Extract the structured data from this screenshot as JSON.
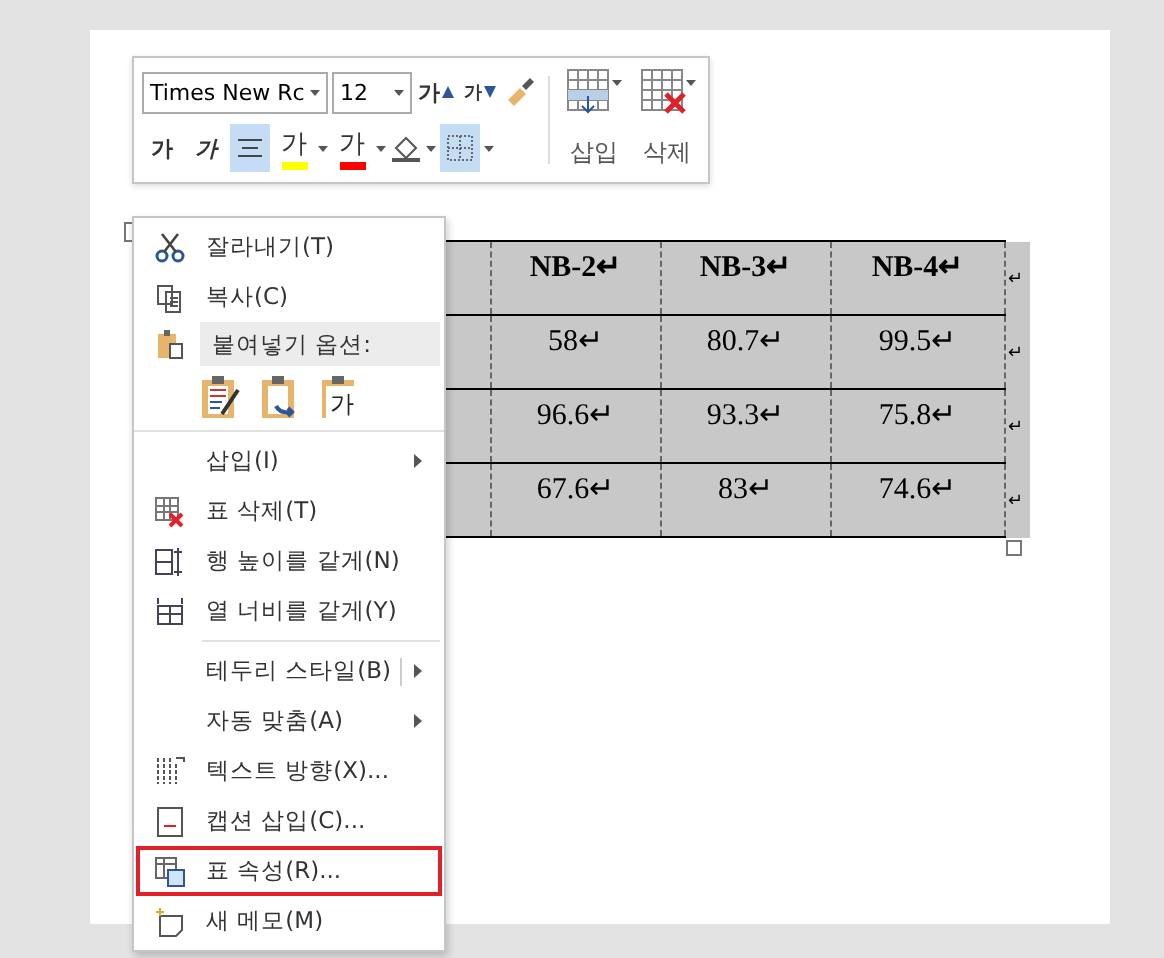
{
  "toolbar": {
    "font": "Times New Rc",
    "size": "12",
    "grow_label": "가",
    "shrink_label": "가",
    "bold_label": "가",
    "italic_label": "가",
    "highlight_label": "가",
    "font_color_label": "가",
    "align_center_selected": true,
    "borders_selected": true,
    "insert_label": "삽입",
    "delete_label": "삭제"
  },
  "table": {
    "rows": [
      {
        "cells": [
          "",
          "NB-2↵",
          "NB-3↵",
          "NB-4↵"
        ],
        "end": "↵"
      },
      {
        "cells": [
          "",
          "58↵",
          "80.7↵",
          "99.5↵"
        ],
        "end": "↵"
      },
      {
        "cells": [
          "",
          "96.6↵",
          "93.3↵",
          "75.8↵"
        ],
        "end": "↵"
      },
      {
        "cells": [
          "",
          "67.6↵",
          "83↵",
          "74.6↵"
        ],
        "end": "↵"
      }
    ]
  },
  "context_menu": {
    "items": [
      {
        "kind": "item",
        "label": "잘라내기(T)",
        "submenu": false,
        "selected": false
      },
      {
        "kind": "item",
        "label": "복사(C)",
        "submenu": false,
        "selected": false
      },
      {
        "kind": "header",
        "label": "붙여넣기 옵션:"
      },
      {
        "kind": "paste",
        "text_option_label": "가"
      },
      {
        "kind": "item",
        "label": "삽입(I)",
        "submenu": true,
        "selected": false
      },
      {
        "kind": "item",
        "label": "표 삭제(T)",
        "submenu": false,
        "selected": false
      },
      {
        "kind": "item",
        "label": "행 높이를 같게(N)",
        "submenu": false,
        "selected": false
      },
      {
        "kind": "item",
        "label": "열 너비를 같게(Y)",
        "submenu": false,
        "selected": false
      },
      {
        "kind": "separator"
      },
      {
        "kind": "item",
        "label": "테두리 스타일(B)",
        "submenu": true,
        "selected": false
      },
      {
        "kind": "item",
        "label": "자동 맞춤(A)",
        "submenu": true,
        "selected": false
      },
      {
        "kind": "item",
        "label": "텍스트 방향(X)...",
        "submenu": false,
        "selected": false
      },
      {
        "kind": "item",
        "label": "캡션 삽입(C)...",
        "submenu": false,
        "selected": false
      },
      {
        "kind": "item",
        "label": "표 속성(R)...",
        "submenu": false,
        "selected": true
      },
      {
        "kind": "item",
        "label": "새 메모(M)",
        "submenu": false,
        "selected": false
      }
    ]
  }
}
